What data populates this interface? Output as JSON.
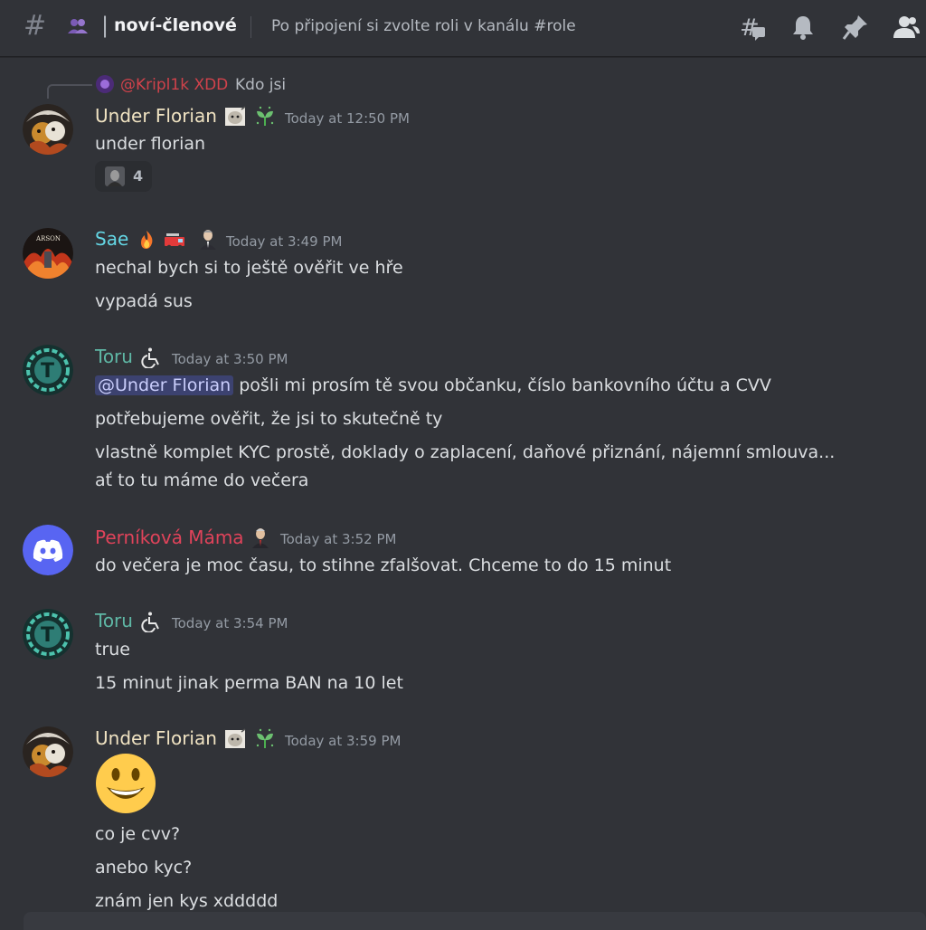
{
  "header": {
    "channel_name": "noví-členové",
    "separator": "|",
    "topic": "Po připojení si zvolte roli v kanálu #role",
    "icons": [
      "threads-icon",
      "bell-icon",
      "pin-icon",
      "members-icon"
    ]
  },
  "colors": {
    "background": "#313338",
    "under_florian": "#f0e3c2",
    "sae": "#64d7e5",
    "toru": "#5fb8a6",
    "pernikova": "#e0435a",
    "mention_bg": "#3c4270",
    "discord_blurple": "#5865f2"
  },
  "messages": [
    {
      "reply": {
        "author": "@Kripl1k XDD",
        "text": "Kdo jsi"
      },
      "author": "Under Florian",
      "timestamp": "Today at 12:50 PM",
      "lines": [
        "under florian"
      ],
      "reaction": {
        "count": "4"
      }
    },
    {
      "author": "Sae",
      "timestamp": "Today at 3:49 PM",
      "lines": [
        "nechal bych si to ještě ověřit ve hře",
        "vypadá sus"
      ]
    },
    {
      "author": "Toru",
      "timestamp": "Today at 3:50 PM",
      "mention": "@Under Florian",
      "lines": [
        " pošli mi prosím tě svou občanku, číslo bankovního účtu a CVV",
        "potřebujeme ověřit, že jsi to skutečně ty",
        "vlastně komplet KYC prostě, doklady o zaplacení, daňové přiznání, nájemní smlouva...",
        "ať to tu máme do večera"
      ]
    },
    {
      "author": "Perníková Máma",
      "timestamp": "Today at 3:52 PM",
      "lines": [
        "do večera je moc času, to stihne zfalšovat. Chceme to do 15 minut"
      ]
    },
    {
      "author": "Toru",
      "timestamp": "Today at 3:54 PM",
      "lines": [
        "true",
        "15 minut jinak perma BAN na 10 let"
      ]
    },
    {
      "author": "Under Florian",
      "timestamp": "Today at 3:59 PM",
      "emoji": "smiley",
      "lines": [
        "co je cvv?",
        "anebo kyc?",
        "znám jen kys xddddd"
      ]
    }
  ]
}
